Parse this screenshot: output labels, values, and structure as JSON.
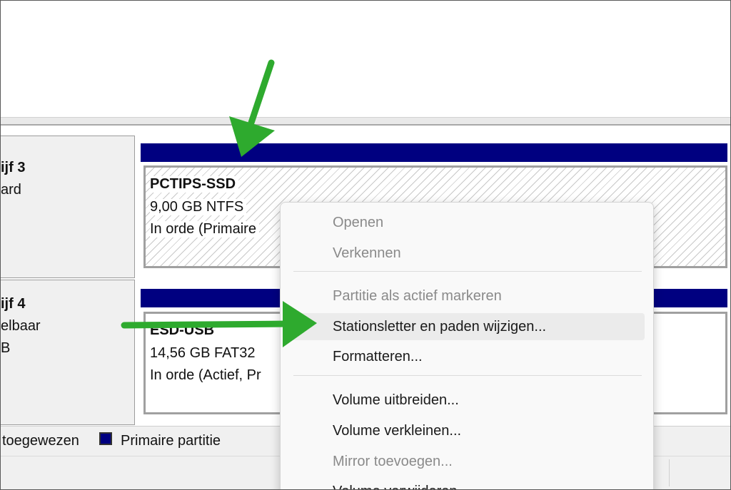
{
  "disks": [
    {
      "name": "ijf 3",
      "type": "ard",
      "size": "",
      "status": "",
      "partition": {
        "label": "PCTIPS-SSD",
        "size": "9,00 GB NTFS",
        "status": "In orde (Primaire"
      }
    },
    {
      "name": "ijf 4",
      "type": "elbaar",
      "size": "B",
      "partition": {
        "label": "ESD-USB",
        "size": "14,56 GB FAT32",
        "status": "In orde (Actief, Pr"
      }
    }
  ],
  "legend": {
    "unallocated_label": "toegewezen",
    "primary_label": "Primaire partitie",
    "primary_color": "#000080"
  },
  "context_menu": {
    "items": [
      {
        "label": "Openen",
        "enabled": false
      },
      {
        "label": "Verkennen",
        "enabled": false
      },
      {
        "label": "Partitie als actief markeren",
        "enabled": false
      },
      {
        "label": "Stationsletter en paden wijzigen...",
        "enabled": true,
        "highlighted": true
      },
      {
        "label": "Formatteren...",
        "enabled": true
      },
      {
        "label": "Volume uitbreiden...",
        "enabled": true
      },
      {
        "label": "Volume verkleinen...",
        "enabled": true
      },
      {
        "label": "Mirror toevoegen...",
        "enabled": false
      },
      {
        "label": "Volume verwijderen...",
        "enabled": true
      }
    ]
  },
  "annotation": {
    "arrow_color": "#2eaa2e"
  }
}
